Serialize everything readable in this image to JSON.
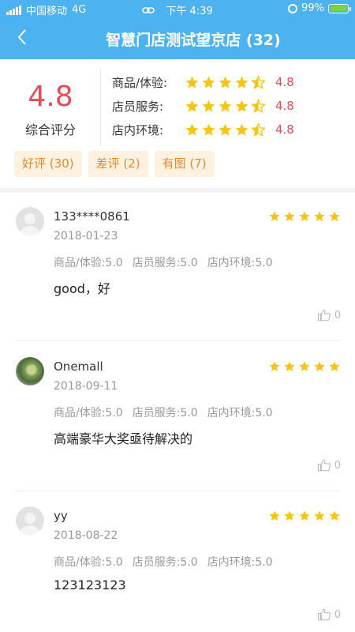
{
  "status_bar": {
    "carrier": "中国移动",
    "network": "4G",
    "time": "下午 4:39",
    "battery_percent": "99%",
    "battery_level": 0.99,
    "icons": [
      "signal-icon",
      "link-icon",
      "alarm-icon",
      "battery-icon"
    ]
  },
  "header": {
    "title": "智慧门店测试望京店 (32)",
    "back_icon": "chevron-left-icon"
  },
  "summary": {
    "overall_score": "4.8",
    "overall_label": "综合评分",
    "categories": [
      {
        "label": "商品/体验:",
        "stars": 4.5,
        "value": "4.8"
      },
      {
        "label": "店员服务:",
        "stars": 4.5,
        "value": "4.8"
      },
      {
        "label": "店内环境:",
        "stars": 4.5,
        "value": "4.8"
      }
    ]
  },
  "filters": [
    {
      "label": "好评 (30)"
    },
    {
      "label": "差评 (2)"
    },
    {
      "label": "有图 (7)"
    }
  ],
  "colors": {
    "header_bg": "#4cb2f0",
    "score_red": "#e74a5b",
    "star_yellow": "#f7c414",
    "chip_bg": "#fff1e0",
    "chip_text": "#e28b2d"
  },
  "reviews": [
    {
      "user": "133****0861",
      "date": "2018-01-23",
      "stars": 5,
      "avatar": "default-avatar",
      "sub_ratings": [
        "商品/体验:5.0",
        "店员服务:5.0",
        "店内环境:5.0"
      ],
      "content": "good，好",
      "likes": "0"
    },
    {
      "user": "Onemall",
      "date": "2018-09-11",
      "stars": 5,
      "avatar": "photo-avatar",
      "sub_ratings": [
        "商品/体验:5.0",
        "店员服务:5.0",
        "店内环境:5.0"
      ],
      "content": "高端豪华大奖亟待解决的",
      "likes": "0"
    },
    {
      "user": "yy",
      "date": "2018-08-22",
      "stars": 5,
      "avatar": "default-avatar",
      "sub_ratings": [
        "商品/体验:5.0",
        "店员服务:5.0",
        "店内环境:5.0"
      ],
      "content": "123123123",
      "likes": "0"
    }
  ]
}
